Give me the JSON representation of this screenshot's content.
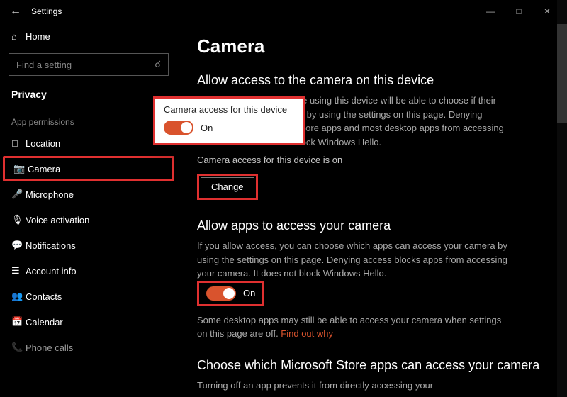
{
  "titlebar": {
    "title": "Settings"
  },
  "sidebar": {
    "home_label": "Home",
    "search_placeholder": "Find a setting",
    "category": "Privacy",
    "group_label": "App permissions",
    "items": [
      {
        "label": "Location"
      },
      {
        "label": "Camera"
      },
      {
        "label": "Microphone"
      },
      {
        "label": "Voice activation"
      },
      {
        "label": "Notifications"
      },
      {
        "label": "Account info"
      },
      {
        "label": "Contacts"
      },
      {
        "label": "Calendar"
      },
      {
        "label": "Phone calls"
      }
    ]
  },
  "main": {
    "heading": "Camera",
    "section1": {
      "title": "Allow access to the camera on this device",
      "desc": "If you allow access, people using this device will be able to choose if their apps have camera access by using the settings on this page. Denying access blocks Microsoft Store apps and most desktop apps from accessing the camera. It does not block Windows Hello.",
      "status": "Camera access for this device is on",
      "change_label": "Change"
    },
    "section2": {
      "title": "Allow apps to access your camera",
      "desc": "If you allow access, you can choose which apps can access your camera by using the settings on this page. Denying access blocks apps from accessing your camera. It does not block Windows Hello.",
      "toggle_label": "On",
      "note_a": "Some desktop apps may still be able to access your camera when settings on this page are off. ",
      "note_link": "Find out why"
    },
    "section3": {
      "title": "Choose which Microsoft Store apps can access your camera",
      "desc": "Turning off an app prevents it from directly accessing your"
    }
  },
  "popup": {
    "title": "Camera access for this device",
    "toggle_label": "On"
  }
}
